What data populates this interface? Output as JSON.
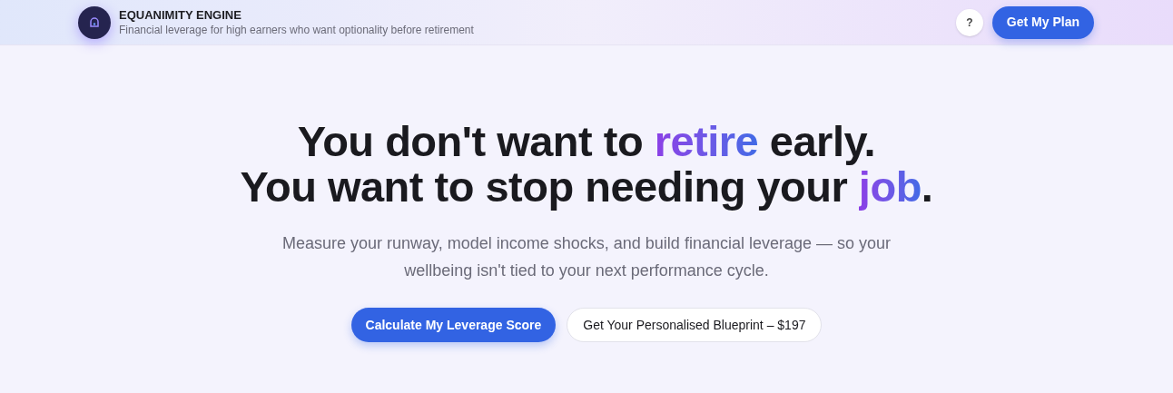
{
  "header": {
    "brand": "EQUANIMITY ENGINE",
    "tagline": "Financial leverage for high earners who want optionality before retirement",
    "help_button": "?",
    "cta_button": "Get My Plan"
  },
  "hero": {
    "headline_lines": [
      [
        {
          "text": "You don't want to ",
          "accent": false
        },
        {
          "text": "retire",
          "accent": true
        },
        {
          "text": " early.",
          "accent": false
        }
      ],
      [
        {
          "text": "You want to stop needing your ",
          "accent": false
        },
        {
          "text": "job",
          "accent": true
        },
        {
          "text": ".",
          "accent": false
        }
      ]
    ],
    "subtitle": "Measure your runway, model income shocks, and build financial leverage — so your wellbeing isn't tied to your next performance cycle.",
    "buttons": [
      {
        "label": "Calculate My Leverage Score",
        "kind": "primary"
      },
      {
        "label": "Get Your Personalised Blueprint – $197",
        "kind": "secondary"
      }
    ]
  }
}
